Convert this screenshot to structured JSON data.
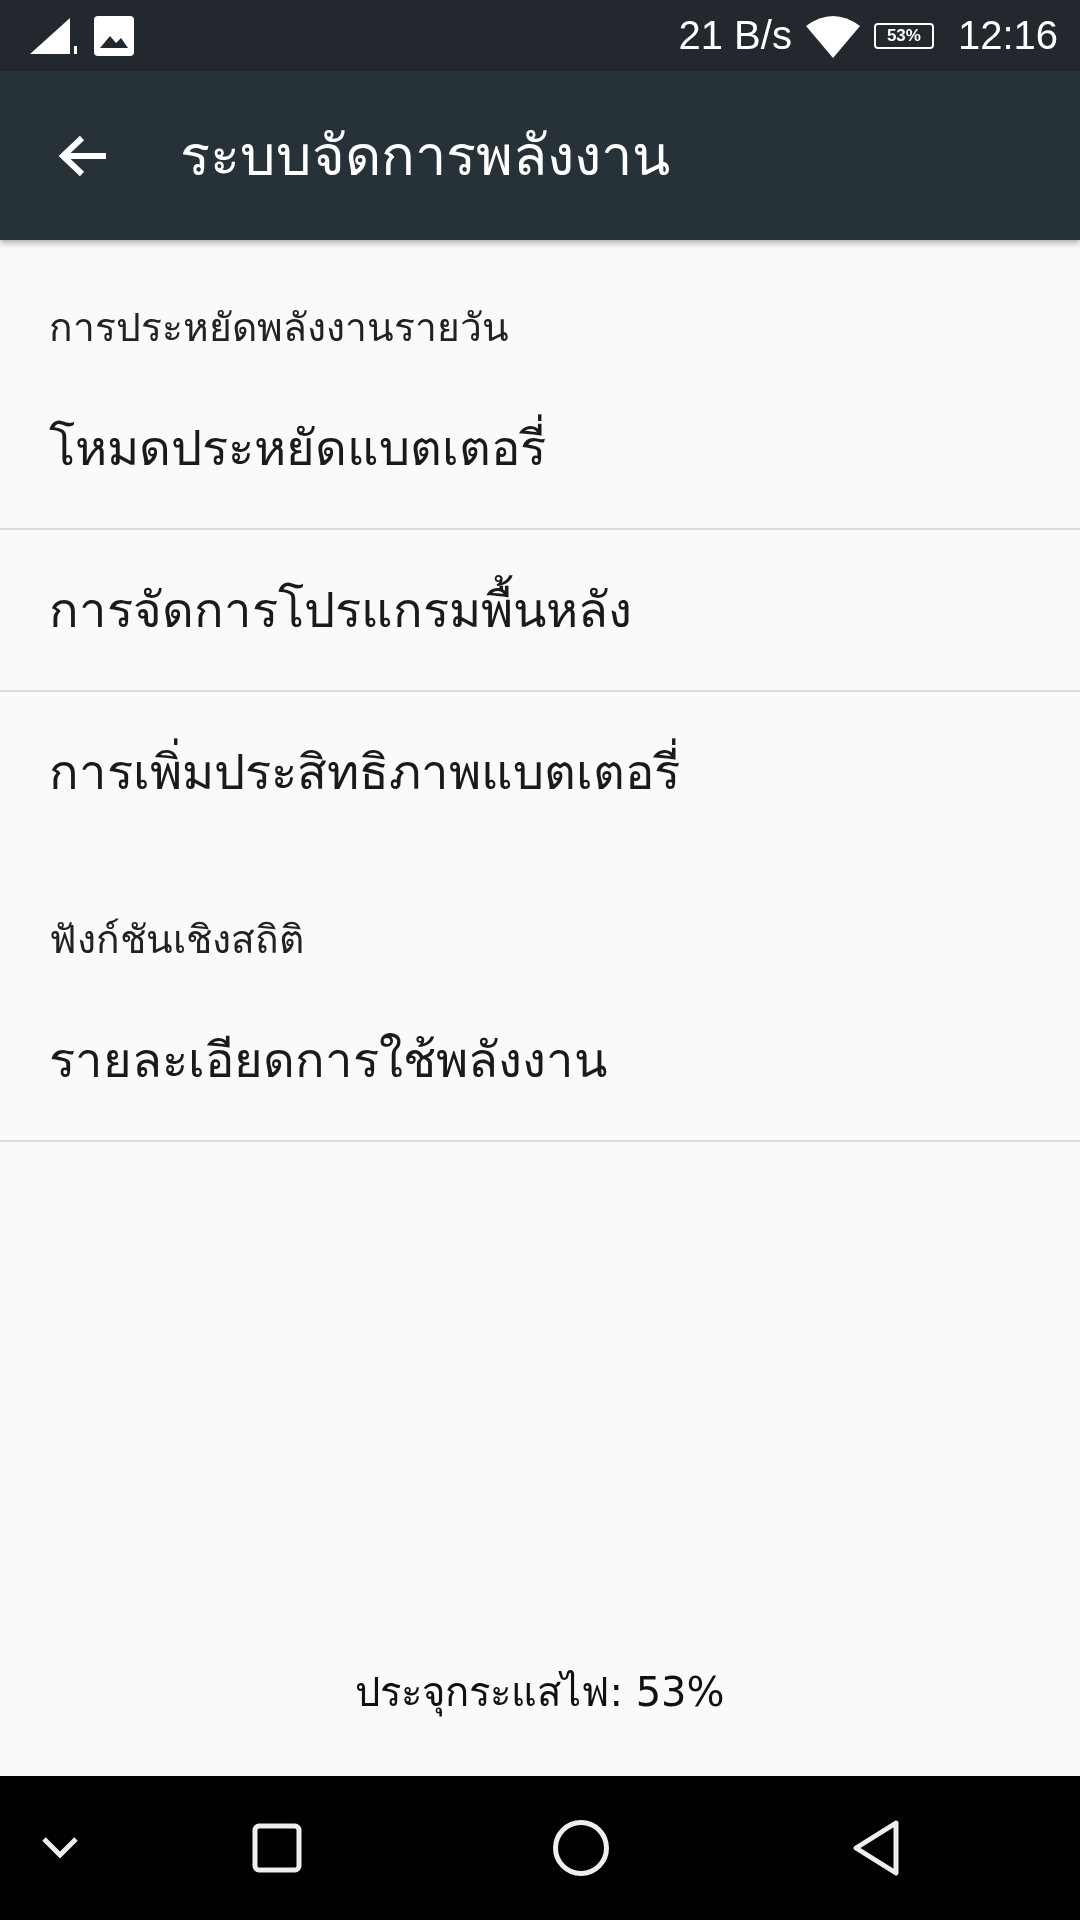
{
  "status_bar": {
    "speed": "21 B/s",
    "battery": "53%",
    "time": "12:16"
  },
  "toolbar": {
    "title": "ระบบจัดการพลังงาน"
  },
  "sections": [
    {
      "header": "การประหยัดพลังงานรายวัน",
      "items": [
        {
          "label": "โหมดประหยัดแบตเตอรี่",
          "divider": true
        },
        {
          "label": "การจัดการโปรแกรมพื้นหลัง",
          "divider": true
        },
        {
          "label": "การเพิ่มประสิทธิภาพแบตเตอรี่",
          "divider": false
        }
      ]
    },
    {
      "header": "ฟังก์ชันเชิงสถิติ",
      "items": [
        {
          "label": "รายละเอียดการใช้พลังงาน",
          "divider": true
        }
      ]
    }
  ],
  "footer": "ประจุกระแสไฟ: 53%"
}
